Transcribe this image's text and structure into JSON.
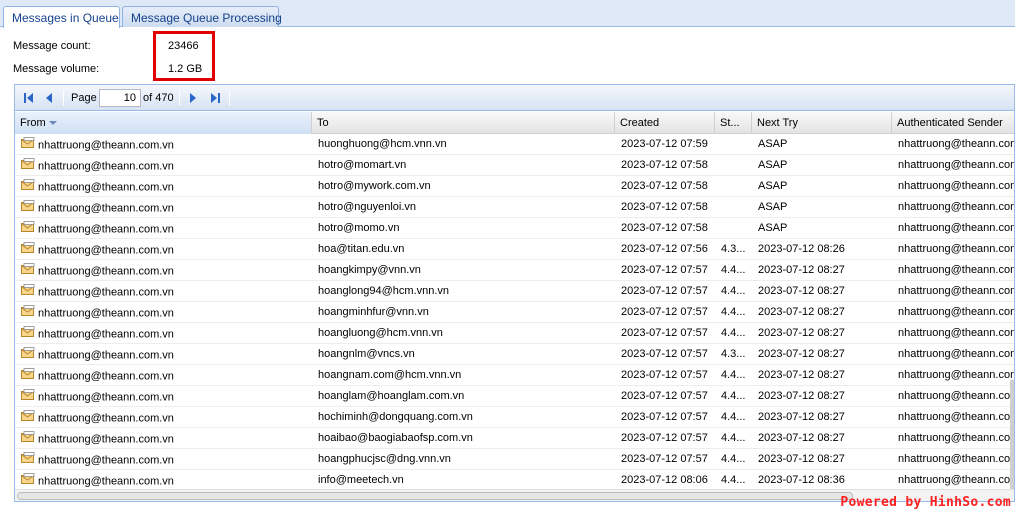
{
  "tabs": [
    {
      "label": "Messages in Queue",
      "active": true
    },
    {
      "label": "Message Queue Processing",
      "active": false
    }
  ],
  "summary": {
    "count_label": "Message count:",
    "count_value": "23466",
    "volume_label": "Message volume:",
    "volume_value": "1.2 GB"
  },
  "pager": {
    "page_label": "Page",
    "page_value": "10",
    "of_text": "of 470"
  },
  "columns": {
    "from": "From",
    "to": "To",
    "created": "Created",
    "status": "St...",
    "next_try": "Next Try",
    "auth": "Authenticated Sender"
  },
  "rows": [
    {
      "from": "nhattruong@theann.com.vn",
      "to": "huonghuong@hcm.vnn.vn",
      "created": "2023-07-12 07:59",
      "status": "",
      "next_try": "ASAP",
      "auth": "nhattruong@theann.com.vn"
    },
    {
      "from": "nhattruong@theann.com.vn",
      "to": "hotro@momart.vn",
      "created": "2023-07-12 07:58",
      "status": "",
      "next_try": "ASAP",
      "auth": "nhattruong@theann.com.vn"
    },
    {
      "from": "nhattruong@theann.com.vn",
      "to": "hotro@mywork.com.vn",
      "created": "2023-07-12 07:58",
      "status": "",
      "next_try": "ASAP",
      "auth": "nhattruong@theann.com.vn"
    },
    {
      "from": "nhattruong@theann.com.vn",
      "to": "hotro@nguyenloi.vn",
      "created": "2023-07-12 07:58",
      "status": "",
      "next_try": "ASAP",
      "auth": "nhattruong@theann.com.vn"
    },
    {
      "from": "nhattruong@theann.com.vn",
      "to": "hotro@momo.vn",
      "created": "2023-07-12 07:58",
      "status": "",
      "next_try": "ASAP",
      "auth": "nhattruong@theann.com.vn"
    },
    {
      "from": "nhattruong@theann.com.vn",
      "to": "hoa@titan.edu.vn",
      "created": "2023-07-12 07:56",
      "status": "4.3...",
      "next_try": "2023-07-12 08:26",
      "auth": "nhattruong@theann.com.vn"
    },
    {
      "from": "nhattruong@theann.com.vn",
      "to": "hoangkimpy@vnn.vn",
      "created": "2023-07-12 07:57",
      "status": "4.4...",
      "next_try": "2023-07-12 08:27",
      "auth": "nhattruong@theann.com.vn"
    },
    {
      "from": "nhattruong@theann.com.vn",
      "to": "hoanglong94@hcm.vnn.vn",
      "created": "2023-07-12 07:57",
      "status": "4.4...",
      "next_try": "2023-07-12 08:27",
      "auth": "nhattruong@theann.com.vn"
    },
    {
      "from": "nhattruong@theann.com.vn",
      "to": "hoangminhfur@vnn.vn",
      "created": "2023-07-12 07:57",
      "status": "4.4...",
      "next_try": "2023-07-12 08:27",
      "auth": "nhattruong@theann.com.vn"
    },
    {
      "from": "nhattruong@theann.com.vn",
      "to": "hoangluong@hcm.vnn.vn",
      "created": "2023-07-12 07:57",
      "status": "4.4...",
      "next_try": "2023-07-12 08:27",
      "auth": "nhattruong@theann.com.vn"
    },
    {
      "from": "nhattruong@theann.com.vn",
      "to": "hoangnlm@vncs.vn",
      "created": "2023-07-12 07:57",
      "status": "4.3...",
      "next_try": "2023-07-12 08:27",
      "auth": "nhattruong@theann.com.vn"
    },
    {
      "from": "nhattruong@theann.com.vn",
      "to": "hoangnam.com@hcm.vnn.vn",
      "created": "2023-07-12 07:57",
      "status": "4.4...",
      "next_try": "2023-07-12 08:27",
      "auth": "nhattruong@theann.com.vn"
    },
    {
      "from": "nhattruong@theann.com.vn",
      "to": "hoanglam@hoanglam.com.vn",
      "created": "2023-07-12 07:57",
      "status": "4.4...",
      "next_try": "2023-07-12 08:27",
      "auth": "nhattruong@theann.com.vn"
    },
    {
      "from": "nhattruong@theann.com.vn",
      "to": "hochiminh@dongquang.com.vn",
      "created": "2023-07-12 07:57",
      "status": "4.4...",
      "next_try": "2023-07-12 08:27",
      "auth": "nhattruong@theann.com.vn"
    },
    {
      "from": "nhattruong@theann.com.vn",
      "to": "hoaibao@baogiabaofsp.com.vn",
      "created": "2023-07-12 07:57",
      "status": "4.4...",
      "next_try": "2023-07-12 08:27",
      "auth": "nhattruong@theann.com.vn"
    },
    {
      "from": "nhattruong@theann.com.vn",
      "to": "hoangphucjsc@dng.vnn.vn",
      "created": "2023-07-12 07:57",
      "status": "4.4...",
      "next_try": "2023-07-12 08:27",
      "auth": "nhattruong@theann.com.vn"
    },
    {
      "from": "nhattruong@theann.com.vn",
      "to": "info@meetech.vn",
      "created": "2023-07-12 08:06",
      "status": "4.4...",
      "next_try": "2023-07-12 08:36",
      "auth": "nhattruong@theann.com.vn"
    }
  ],
  "icons": {
    "first_page": "first-page-icon",
    "prev_page": "prev-page-icon",
    "next_page": "next-page-icon",
    "last_page": "last-page-icon",
    "message": "envelope-icon"
  },
  "colors": {
    "highlight_border": "#e00000",
    "pager_icon": "#2a65c8",
    "tab_text": "#15428b",
    "watermark": "#ff2020"
  },
  "watermark": "Powered by HinhSo.com"
}
